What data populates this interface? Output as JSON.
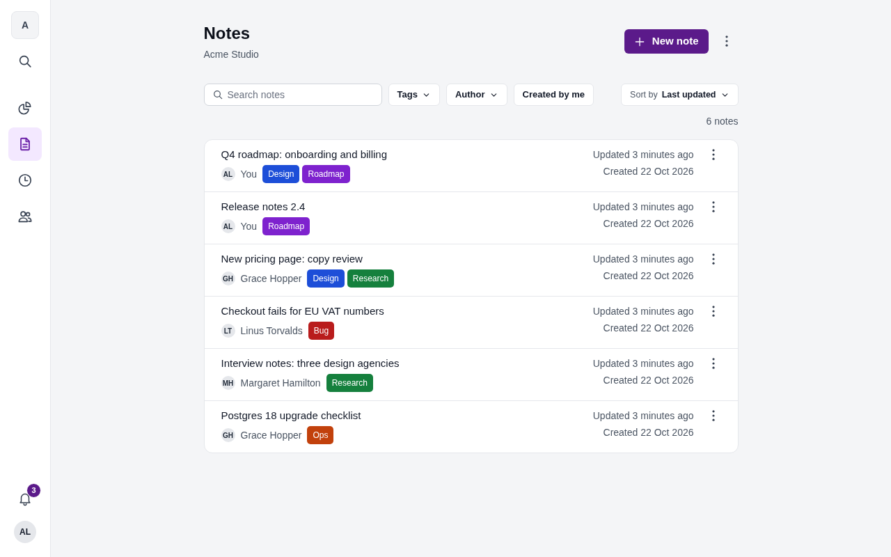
{
  "sidebar": {
    "workspace": "A",
    "actions": [
      {
        "kind": "search"
      }
    ],
    "nav": [
      {
        "kind": "chart",
        "selected": false
      },
      {
        "kind": "document",
        "selected": true
      },
      {
        "kind": "clock",
        "selected": false
      },
      {
        "kind": "users",
        "selected": false
      }
    ],
    "notifications": {
      "count": "3"
    },
    "user_avatar": "AL"
  },
  "header": {
    "title": "Notes",
    "subtitle": "Acme Studio",
    "new_button": "New note"
  },
  "filters": {
    "search_placeholder": "Search notes",
    "buttons": [
      {
        "kind": "dropdown",
        "label": "Tags"
      },
      {
        "kind": "dropdown",
        "label": "Author"
      },
      {
        "kind": "button",
        "label": "Created by me"
      }
    ],
    "sort": {
      "label": "Sort by",
      "value": "Last updated"
    }
  },
  "count": "6 notes",
  "notes": [
    {
      "title": "Q4 roadmap: onboarding and billing",
      "initials": "AL",
      "author": "You",
      "tags": [
        {
          "label": "Design",
          "color": "#1d4ed8"
        },
        {
          "label": "Roadmap",
          "color": "#7e22ce"
        }
      ],
      "updated": "Updated 3 minutes ago",
      "created": "Created 22 Oct 2026"
    },
    {
      "title": "Release notes 2.4",
      "initials": "AL",
      "author": "You",
      "tags": [
        {
          "label": "Roadmap",
          "color": "#7e22ce"
        }
      ],
      "updated": "Updated 3 minutes ago",
      "created": "Created 22 Oct 2026"
    },
    {
      "title": "New pricing page: copy review",
      "initials": "GH",
      "author": "Grace Hopper",
      "tags": [
        {
          "label": "Design",
          "color": "#1d4ed8"
        },
        {
          "label": "Research",
          "color": "#15803d"
        }
      ],
      "updated": "Updated 3 minutes ago",
      "created": "Created 22 Oct 2026"
    },
    {
      "title": "Checkout fails for EU VAT numbers",
      "initials": "LT",
      "author": "Linus Torvalds",
      "tags": [
        {
          "label": "Bug",
          "color": "#b91c1c"
        }
      ],
      "updated": "Updated 3 minutes ago",
      "created": "Created 22 Oct 2026"
    },
    {
      "title": "Interview notes: three design agencies",
      "initials": "MH",
      "author": "Margaret Hamilton",
      "tags": [
        {
          "label": "Research",
          "color": "#15803d"
        }
      ],
      "updated": "Updated 3 minutes ago",
      "created": "Created 22 Oct 2026"
    },
    {
      "title": "Postgres 18 upgrade checklist",
      "initials": "GH",
      "author": "Grace Hopper",
      "tags": [
        {
          "label": "Ops",
          "color": "#c2410c"
        }
      ],
      "updated": "Updated 3 minutes ago",
      "created": "Created 22 Oct 2026"
    }
  ]
}
